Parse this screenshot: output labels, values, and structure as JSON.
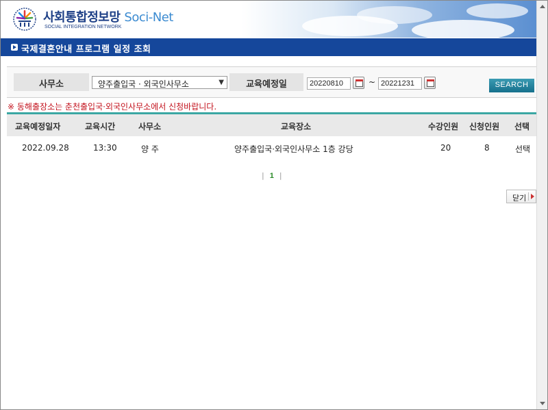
{
  "header": {
    "title_ko": "사회통합정보망",
    "title_en": "Soci-Net",
    "subtitle": "SOCIAL INTEGRATION NETWORK"
  },
  "page_title": "국제결혼안내 프로그램 일정 조회",
  "search": {
    "office_label": "사무소",
    "office_value": "양주출입국 · 외국인사무소",
    "date_label": "교육예정일",
    "date_from": "20220810",
    "date_separator": "~",
    "date_to": "20221231",
    "search_button": "SEARCH"
  },
  "notice": "※ 동해출장소는 춘천출입국·외국인사무소에서 신청바랍니다.",
  "table": {
    "headers": [
      "교육예정일자",
      "교육시간",
      "사무소",
      "교육장소",
      "수강인원",
      "신청인원",
      "선택"
    ],
    "rows": [
      [
        "2022.09.28",
        "13:30",
        "양 주",
        "양주출입국·외국인사무소 1층 강당",
        "20",
        "8",
        "선택"
      ]
    ]
  },
  "pagination": {
    "left_sep": "|",
    "current": "1",
    "right_sep": "|"
  },
  "close_button": "닫기",
  "colors": {
    "title_bar": "#15479b",
    "teal_line": "#3ba7a3",
    "notice": "#c3131e",
    "search_button": "#16708c",
    "page_number": "#2a8a27"
  }
}
